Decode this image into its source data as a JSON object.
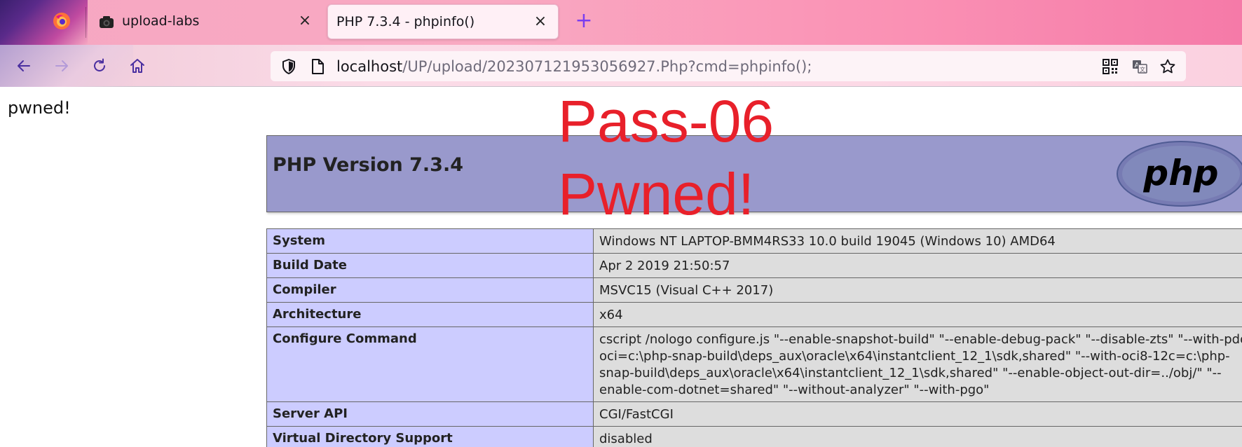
{
  "tabs": [
    {
      "label": "upload-labs",
      "icon": "camera-icon",
      "active": false
    },
    {
      "label": "PHP 7.3.4 - phpinfo()",
      "icon": "",
      "active": true
    }
  ],
  "close_glyph": "×",
  "new_tab_glyph": "+",
  "url": {
    "host": "localhost",
    "path": "/UP/upload/202307121953056927.Php?cmd=phpinfo();"
  },
  "page": {
    "output": "pwned!",
    "overlay_line1": "Pass-06",
    "overlay_line2": "Pwned!",
    "php_heading": "PHP Version 7.3.4",
    "logo_text": "php",
    "rows": [
      {
        "key": "System",
        "value": "Windows NT LAPTOP-BMM4RS33 10.0 build 19045 (Windows 10) AMD64"
      },
      {
        "key": "Build Date",
        "value": "Apr 2 2019 21:50:57"
      },
      {
        "key": "Compiler",
        "value": "MSVC15 (Visual C++ 2017)"
      },
      {
        "key": "Architecture",
        "value": "x64"
      },
      {
        "key": "Configure Command",
        "value": "cscript /nologo configure.js \"--enable-snapshot-build\" \"--enable-debug-pack\" \"--disable-zts\" \"--with-pdo-oci=c:\\php-snap-build\\deps_aux\\oracle\\x64\\instantclient_12_1\\sdk,shared\" \"--with-oci8-12c=c:\\php-snap-build\\deps_aux\\oracle\\x64\\instantclient_12_1\\sdk,shared\" \"--enable-object-out-dir=../obj/\" \"--enable-com-dotnet=shared\" \"--without-analyzer\" \"--with-pgo\""
      },
      {
        "key": "Server API",
        "value": "CGI/FastCGI"
      },
      {
        "key": "Virtual Directory Support",
        "value": "disabled"
      }
    ]
  },
  "colors": {
    "overlay_red": "#e8202a",
    "php_header_bg": "#9999cc",
    "key_cell_bg": "#ccccff",
    "value_cell_bg": "#dddddd",
    "accent_purple": "#7a3df0"
  }
}
